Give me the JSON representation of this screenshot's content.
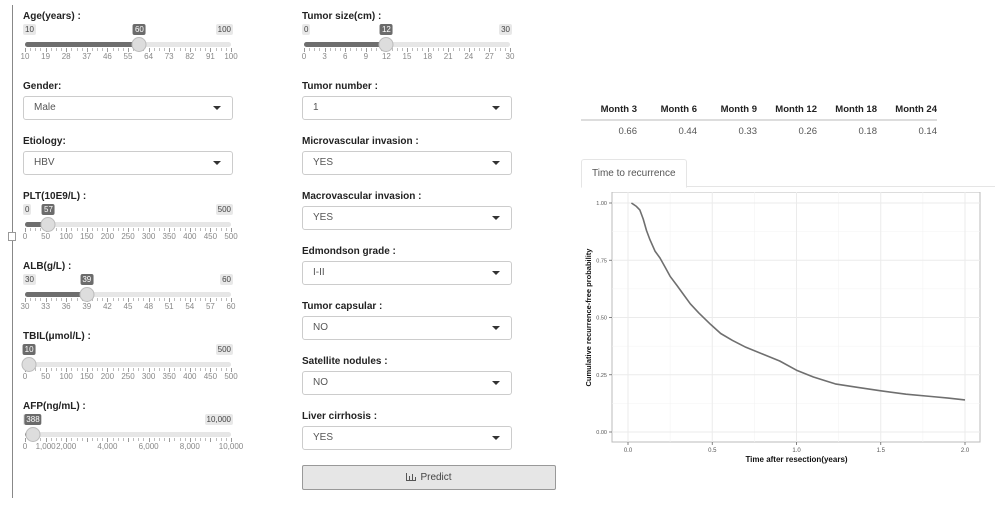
{
  "sliders": {
    "age": {
      "label": "Age(years) :",
      "min": 10,
      "max": 100,
      "value": 60,
      "min_label": "10",
      "max_label": "100",
      "value_label": "60",
      "tick_labels": [
        "10",
        "19",
        "28",
        "37",
        "46",
        "55",
        "64",
        "73",
        "82",
        "91",
        "100"
      ]
    },
    "plt": {
      "label": "PLT(10E9/L) :",
      "min": 0,
      "max": 500,
      "value": 57,
      "min_label": "0",
      "max_label": "500",
      "value_label": "57",
      "tick_labels": [
        "0",
        "50",
        "100",
        "150",
        "200",
        "250",
        "300",
        "350",
        "400",
        "450",
        "500"
      ]
    },
    "alb": {
      "label": "ALB(g/L) :",
      "min": 30,
      "max": 60,
      "value": 39,
      "min_label": "30",
      "max_label": "60",
      "value_label": "39",
      "tick_labels": [
        "30",
        "33",
        "36",
        "39",
        "42",
        "45",
        "48",
        "51",
        "54",
        "57",
        "60"
      ]
    },
    "tbil": {
      "label": "TBIL(μmol/L) :",
      "min": 0,
      "max": 500,
      "value": 10,
      "min_label": "0",
      "max_label": "500",
      "value_label": "10",
      "tick_labels": [
        "0",
        "50",
        "100",
        "150",
        "200",
        "250",
        "300",
        "350",
        "400",
        "450",
        "500"
      ]
    },
    "afp": {
      "label": "AFP(ng/mL) :",
      "min": 0,
      "max": 10000,
      "value": 388,
      "min_label": "0",
      "max_label": "10,000",
      "value_label": "388",
      "tick_labels": [
        "0",
        "1,000",
        "2,000",
        "4,000",
        "6,000",
        "8,000",
        "10,000"
      ],
      "tick_values": [
        0,
        1000,
        2000,
        4000,
        6000,
        8000,
        10000
      ]
    },
    "tumor_size": {
      "label": "Tumor size(cm) :",
      "min": 0,
      "max": 30,
      "value": 12,
      "min_label": "0",
      "max_label": "30",
      "value_label": "12",
      "tick_labels": [
        "0",
        "3",
        "6",
        "9",
        "12",
        "15",
        "18",
        "21",
        "24",
        "27",
        "30"
      ]
    }
  },
  "selects": {
    "gender": {
      "label": "Gender:",
      "value": "Male"
    },
    "etiology": {
      "label": "Etiology:",
      "value": "HBV"
    },
    "tumor_number": {
      "label": "Tumor number :",
      "value": "1"
    },
    "microvascular_invasion": {
      "label": "Microvascular invasion :",
      "value": "YES"
    },
    "macrovascular_invasion": {
      "label": "Macrovascular invasion :",
      "value": "YES"
    },
    "edmondson_grade": {
      "label": "Edmondson grade :",
      "value": "I-II"
    },
    "tumor_capsular": {
      "label": "Tumor capsular :",
      "value": "NO"
    },
    "satellite_nodules": {
      "label": "Satellite nodules :",
      "value": "NO"
    },
    "liver_cirrhosis": {
      "label": "Liver cirrhosis :",
      "value": "YES"
    }
  },
  "predict_button": {
    "label": "Predict",
    "icon": "bar-chart-icon"
  },
  "results_table": {
    "headers": [
      "Month 3",
      "Month 6",
      "Month 9",
      "Month 12",
      "Month 18",
      "Month 24"
    ],
    "values": [
      "0.66",
      "0.44",
      "0.33",
      "0.26",
      "0.18",
      "0.14"
    ]
  },
  "tabs": [
    {
      "label": "Time to recurrence",
      "active": true
    }
  ],
  "chart_data": {
    "type": "line",
    "title": "",
    "xlabel": "Time after resection(years)",
    "ylabel": "Cumulative recurrence-free probability",
    "xlim": [
      0,
      2
    ],
    "ylim": [
      0,
      1
    ],
    "x_ticks": [
      0,
      0.5,
      1.0,
      1.5,
      2.0
    ],
    "x_tick_labels": [
      "0.0",
      "0.5",
      "1.0",
      "1.5",
      "2.0"
    ],
    "y_ticks": [
      0,
      0.25,
      0.5,
      0.75,
      1.0
    ],
    "y_tick_labels": [
      "0.00",
      "0.25",
      "0.50",
      "0.75",
      "1.00"
    ],
    "grid": true,
    "series": [
      {
        "name": "Time to recurrence",
        "color": "#6f6f6f",
        "x": [
          0.02,
          0.05,
          0.07,
          0.09,
          0.11,
          0.13,
          0.16,
          0.19,
          0.22,
          0.25,
          0.29,
          0.33,
          0.37,
          0.42,
          0.49,
          0.55,
          0.62,
          0.7,
          0.8,
          0.9,
          1.0,
          1.1,
          1.23,
          1.36,
          1.5,
          1.65,
          1.8,
          1.9,
          2.0
        ],
        "y": [
          1.0,
          0.985,
          0.97,
          0.93,
          0.88,
          0.84,
          0.79,
          0.76,
          0.72,
          0.68,
          0.64,
          0.6,
          0.56,
          0.52,
          0.47,
          0.43,
          0.4,
          0.37,
          0.34,
          0.31,
          0.27,
          0.24,
          0.21,
          0.195,
          0.18,
          0.165,
          0.155,
          0.148,
          0.14
        ]
      }
    ]
  }
}
